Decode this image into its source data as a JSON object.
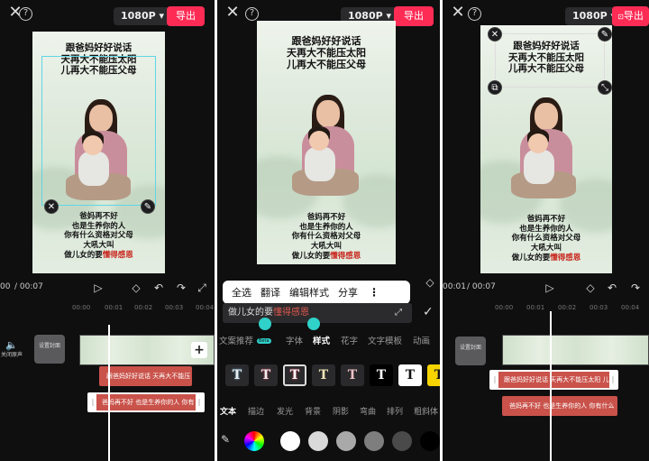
{
  "common": {
    "resolution": "1080P",
    "export_label": "导出",
    "caption_top": [
      "跟爸妈好好说话",
      "天再大不能压太阳",
      "儿再大不能压父母"
    ],
    "caption_bottom": [
      "爸妈再不好",
      "也是生养你的人",
      "你有什么资格对父母",
      "大吼大叫"
    ],
    "caption_last_plain": "做儿女的要",
    "caption_last_red": "懂得感恩",
    "text_clip_1": "跟爸妈好好说话 天再大不能压",
    "text_clip_2": "爸妈再不好 也是生养你的人 你有",
    "cover_label": "设置封面",
    "mute_label": "关闭原声"
  },
  "panel1": {
    "time_current": "00",
    "time_total": "/ 00:07",
    "ruler": [
      "00:00",
      "00:01",
      "00:02",
      "00:03",
      "00:04"
    ]
  },
  "panel2": {
    "context_menu": [
      "全选",
      "翻译",
      "编辑样式",
      "分享"
    ],
    "input_plain": "做儿女的要",
    "input_red": "懂得感恩",
    "tabs": [
      "文案推荐",
      "字体",
      "样式",
      "花字",
      "文字模板",
      "动画"
    ],
    "beta": "Beta",
    "sub_tabs": [
      "文本",
      "描边",
      "发光",
      "背景",
      "阴影",
      "弯曲",
      "排列",
      "粗斜体"
    ],
    "swatches": [
      "#ffffff",
      "#d9d9d9",
      "#a9a9a9",
      "#7e7e7e",
      "#4a4a4a",
      "#000000"
    ]
  },
  "panel3": {
    "time_current": "00:01",
    "time_total": "/ 00:07",
    "ruler": [
      "00:00",
      "00:01",
      "00:02",
      "00:03",
      "00:04"
    ],
    "text_clip_1": "跟爸妈好好说话 天再大不能压太阳 儿",
    "text_clip_2": "爸妈再不好 也是生养你的人 你有什么"
  }
}
